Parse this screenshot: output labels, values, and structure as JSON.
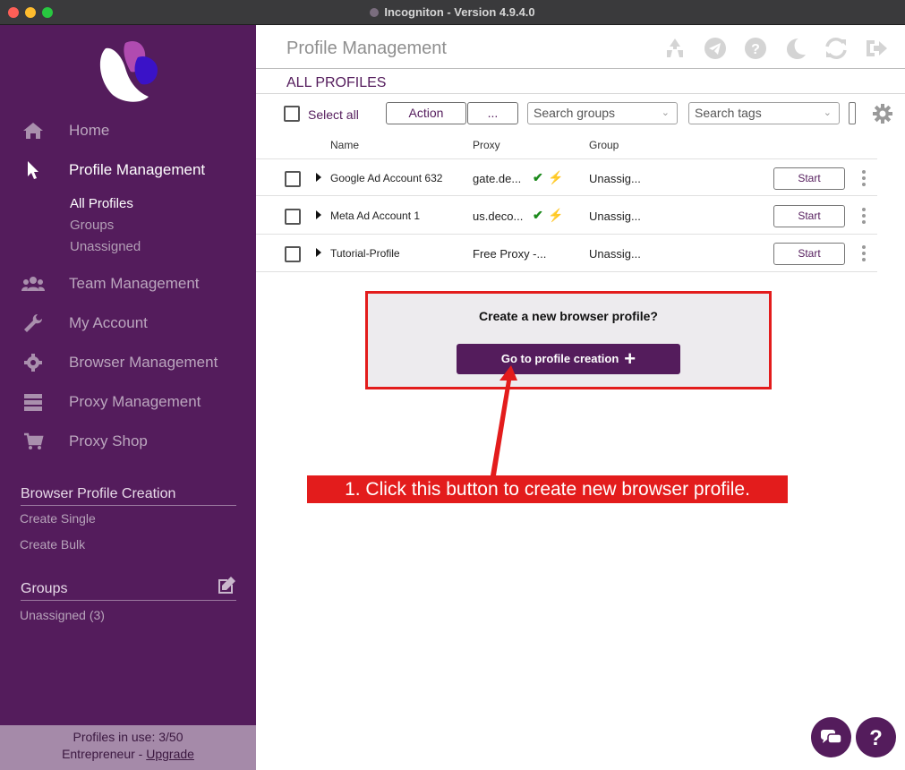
{
  "window": {
    "title": "Incogniton - Version 4.9.4.0"
  },
  "sidebar": {
    "nav": [
      {
        "label": "Home",
        "icon": "home-icon"
      },
      {
        "label": "Profile Management",
        "icon": "pointer-icon"
      },
      {
        "label": "Team Management",
        "icon": "users-icon"
      },
      {
        "label": "My Account",
        "icon": "wrench-icon"
      },
      {
        "label": "Browser Management",
        "icon": "gear-icon"
      },
      {
        "label": "Proxy Management",
        "icon": "server-icon"
      },
      {
        "label": "Proxy Shop",
        "icon": "cart-icon"
      }
    ],
    "subnav": [
      "All Profiles",
      "Groups",
      "Unassigned"
    ],
    "creation": {
      "heading": "Browser Profile Creation",
      "single": "Create Single",
      "bulk": "Create Bulk"
    },
    "groups": {
      "heading": "Groups",
      "items": [
        "Unassigned (3)"
      ]
    },
    "usage": {
      "line1": "Profiles in use:  3/50",
      "plan": "Entrepreneur - ",
      "upgrade": "Upgrade"
    }
  },
  "main": {
    "title": "Profile Management",
    "section": "ALL PROFILES",
    "toolbar": {
      "select_all": "Select all",
      "action": "Action",
      "more": "...",
      "search_groups": "Search groups",
      "search_tags": "Search tags"
    },
    "columns": [
      "Name",
      "Proxy",
      "Group"
    ],
    "rows": [
      {
        "name": "Google Ad Account 632",
        "proxy": "gate.de...",
        "proxy_ok": true,
        "group": "Unassig...",
        "action": "Start"
      },
      {
        "name": "Meta Ad Account 1",
        "proxy": "us.deco...",
        "proxy_ok": true,
        "group": "Unassig...",
        "action": "Start"
      },
      {
        "name": "Tutorial-Profile",
        "proxy": "Free Proxy -...",
        "proxy_ok": false,
        "group": "Unassig...",
        "action": "Start"
      }
    ],
    "create": {
      "question": "Create a new browser profile?",
      "button": "Go to profile creation"
    },
    "callout": "1. Click this button to create new browser profile."
  },
  "colors": {
    "brand": "#541c5c",
    "callout": "#e31c1c",
    "ok": "#1c8a1c"
  }
}
